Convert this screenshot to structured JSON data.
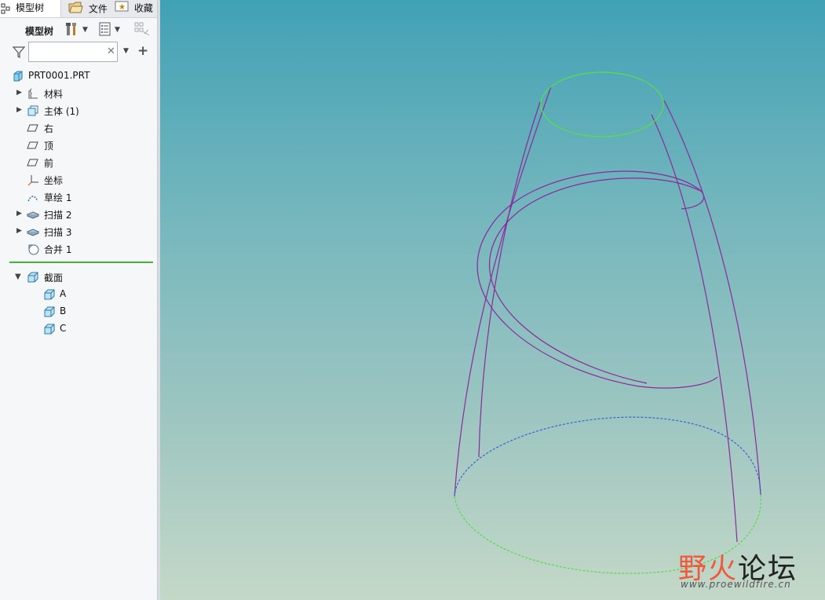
{
  "tabs": [
    {
      "label": "模型树",
      "icon": "model-tree-icon"
    },
    {
      "label": "文件",
      "icon": "folder-icon"
    },
    {
      "label": "收藏",
      "icon": "favorites-icon"
    }
  ],
  "toolbar": {
    "label": "模型树"
  },
  "filter": {
    "value": "",
    "placeholder": ""
  },
  "tree": {
    "root": {
      "label": "PRT0001.PRT",
      "icon": "part-icon"
    },
    "items": [
      {
        "label": "材料",
        "icon": "material-icon",
        "expandable": true
      },
      {
        "label": "主体 (1)",
        "icon": "body-icon",
        "expandable": true
      },
      {
        "label": "右",
        "icon": "datum-plane-icon",
        "expandable": false
      },
      {
        "label": "顶",
        "icon": "datum-plane-icon",
        "expandable": false
      },
      {
        "label": "前",
        "icon": "datum-plane-icon",
        "expandable": false
      },
      {
        "label": "坐标",
        "icon": "coordinate-system-icon",
        "expandable": false
      },
      {
        "label": "草绘 1",
        "icon": "sketch-icon",
        "expandable": false
      },
      {
        "label": "扫描 2",
        "icon": "sweep-icon",
        "expandable": true
      },
      {
        "label": "扫描 3",
        "icon": "sweep-icon",
        "expandable": true
      },
      {
        "label": "合并 1",
        "icon": "merge-icon",
        "expandable": false
      }
    ],
    "sections": {
      "label": "截面",
      "icon": "section-icon",
      "children": [
        {
          "label": "A",
          "icon": "section-icon"
        },
        {
          "label": "B",
          "icon": "section-icon"
        },
        {
          "label": "C",
          "icon": "section-icon"
        }
      ]
    }
  },
  "colors": {
    "sweep_edges": "#8a2a9c",
    "top_sketch": "#55e04a",
    "bottom_curve_blue": "#3c5fd8",
    "bottom_curve_green": "#4ee040",
    "insert_indicator": "#46b33a"
  },
  "watermark": {
    "cn_1": "野火",
    "cn_2": "论坛",
    "url": "www.proewildfire.cn",
    "color_1": "#ef5a3c",
    "color_2": "#222222"
  }
}
